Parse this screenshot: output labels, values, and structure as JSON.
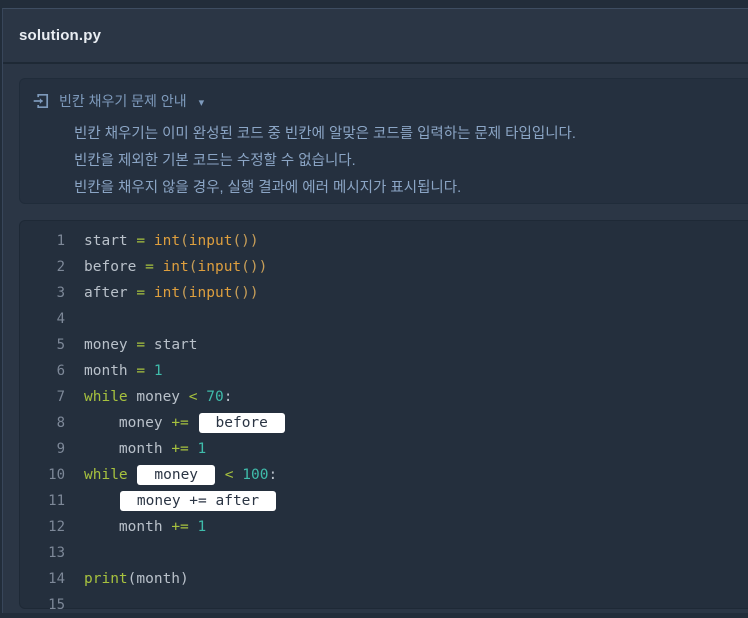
{
  "window": {
    "tab_title": "solution.py"
  },
  "notice": {
    "icon": "box-arrow-in-right-icon",
    "title": "빈칸 채우기 문제 안내",
    "caret": "▾",
    "lines": [
      "빈칸 채우기는 이미 완성된 코드 중 빈칸에 알맞은 코드를 입력하는 문제 타입입니다.",
      "빈칸을 제외한 기본 코드는 수정할 수 없습니다.",
      "빈칸을 채우지 않을 경우, 실행 결과에 에러 메시지가 표시됩니다."
    ]
  },
  "editor": {
    "language": "python",
    "blanks": [
      "before",
      "money",
      "money += after"
    ],
    "lines": [
      {
        "n": "1",
        "tokens": [
          {
            "c": "plain",
            "t": "start "
          },
          {
            "c": "op",
            "t": "="
          },
          {
            "c": "plain",
            "t": " "
          },
          {
            "c": "fn",
            "t": "int"
          },
          {
            "c": "pw",
            "t": "("
          },
          {
            "c": "fn",
            "t": "input"
          },
          {
            "c": "pw",
            "t": "())"
          }
        ]
      },
      {
        "n": "2",
        "tokens": [
          {
            "c": "plain",
            "t": "before "
          },
          {
            "c": "op",
            "t": "="
          },
          {
            "c": "plain",
            "t": " "
          },
          {
            "c": "fn",
            "t": "int"
          },
          {
            "c": "pw",
            "t": "("
          },
          {
            "c": "fn",
            "t": "input"
          },
          {
            "c": "pw",
            "t": "())"
          }
        ]
      },
      {
        "n": "3",
        "tokens": [
          {
            "c": "plain",
            "t": "after "
          },
          {
            "c": "op",
            "t": "="
          },
          {
            "c": "plain",
            "t": " "
          },
          {
            "c": "fn",
            "t": "int"
          },
          {
            "c": "pw",
            "t": "("
          },
          {
            "c": "fn",
            "t": "input"
          },
          {
            "c": "pw",
            "t": "())"
          }
        ]
      },
      {
        "n": "4",
        "tokens": []
      },
      {
        "n": "5",
        "tokens": [
          {
            "c": "plain",
            "t": "money "
          },
          {
            "c": "op",
            "t": "="
          },
          {
            "c": "plain",
            "t": " start"
          }
        ]
      },
      {
        "n": "6",
        "tokens": [
          {
            "c": "plain",
            "t": "month "
          },
          {
            "c": "op",
            "t": "="
          },
          {
            "c": "plain",
            "t": " "
          },
          {
            "c": "num",
            "t": "1"
          }
        ]
      },
      {
        "n": "7",
        "tokens": [
          {
            "c": "kw",
            "t": "while"
          },
          {
            "c": "plain",
            "t": " money "
          },
          {
            "c": "op",
            "t": "<"
          },
          {
            "c": "plain",
            "t": " "
          },
          {
            "c": "num",
            "t": "70"
          },
          {
            "c": "plain",
            "t": ":"
          }
        ]
      },
      {
        "n": "8",
        "tokens": [
          {
            "c": "plain",
            "t": "    money "
          },
          {
            "c": "op",
            "t": "+="
          },
          {
            "c": "plain",
            "t": " "
          },
          {
            "c": "blank",
            "t": "before"
          }
        ]
      },
      {
        "n": "9",
        "tokens": [
          {
            "c": "plain",
            "t": "    month "
          },
          {
            "c": "op",
            "t": "+="
          },
          {
            "c": "plain",
            "t": " "
          },
          {
            "c": "num",
            "t": "1"
          }
        ]
      },
      {
        "n": "10",
        "tokens": [
          {
            "c": "kw",
            "t": "while"
          },
          {
            "c": "plain",
            "t": " "
          },
          {
            "c": "blank",
            "t": "money"
          },
          {
            "c": "plain",
            "t": " "
          },
          {
            "c": "op",
            "t": "<"
          },
          {
            "c": "plain",
            "t": " "
          },
          {
            "c": "num",
            "t": "100"
          },
          {
            "c": "plain",
            "t": ":"
          }
        ]
      },
      {
        "n": "11",
        "tokens": [
          {
            "c": "plain",
            "t": "    "
          },
          {
            "c": "blank",
            "t": "money += after"
          }
        ]
      },
      {
        "n": "12",
        "tokens": [
          {
            "c": "plain",
            "t": "    month "
          },
          {
            "c": "op",
            "t": "+="
          },
          {
            "c": "plain",
            "t": " "
          },
          {
            "c": "num",
            "t": "1"
          }
        ]
      },
      {
        "n": "13",
        "tokens": []
      },
      {
        "n": "14",
        "tokens": [
          {
            "c": "kw",
            "t": "print"
          },
          {
            "c": "plain",
            "t": "(month)"
          }
        ]
      },
      {
        "n": "15",
        "tokens": []
      }
    ]
  },
  "colors": {
    "outer_bg": "#222d3a",
    "window_bg": "#2b3645",
    "notice_bg": "#25303f",
    "code_bg": "#242f3d",
    "tab_title": "#e9edf2",
    "notice_text": "#8ba5c5",
    "keyword_operator": "#a7c23e",
    "builtin_function": "#de9f3e",
    "number": "#3fbcab",
    "plain_code": "#b9c1ca",
    "line_number": "#7d8898",
    "blank_bg": "#ffffff",
    "blank_text": "#2b3544"
  }
}
